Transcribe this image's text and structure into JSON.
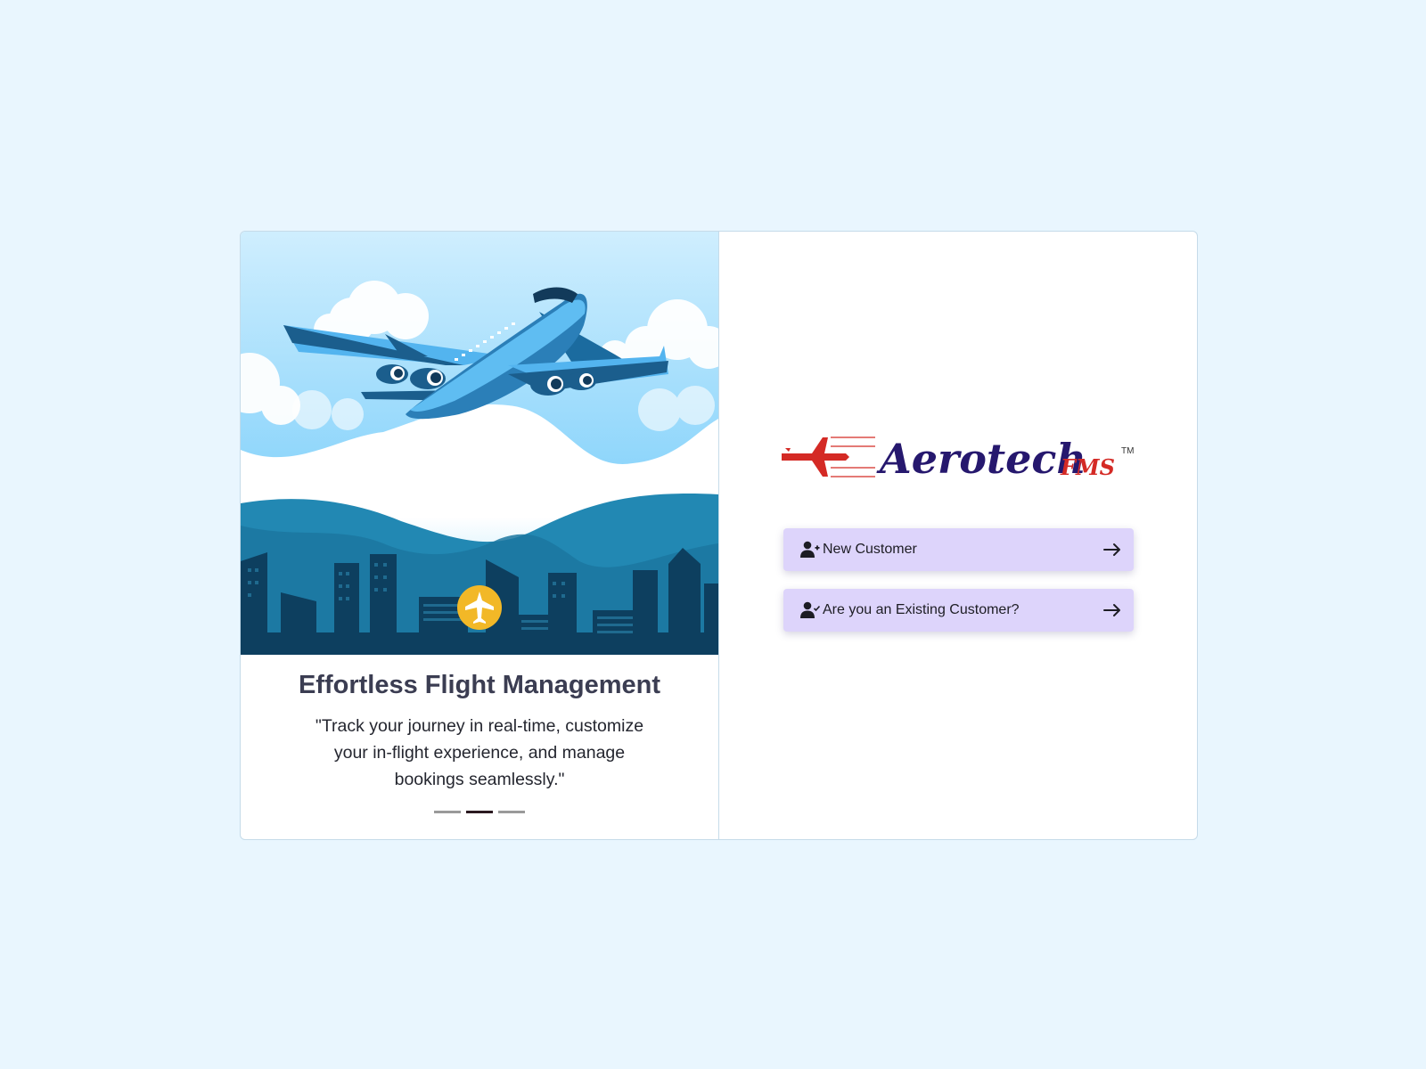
{
  "carousel": {
    "title": "Effortless Flight Management",
    "quote": "\"Track your journey in real-time, customize your in-flight experience, and manage bookings seamlessly.\"",
    "slide_count": 3,
    "active_slide": 2
  },
  "brand": {
    "name": "Aerotech",
    "suffix": "FMS",
    "trademark": "TM",
    "name_color": "#26186e",
    "accent_color": "#d42a25"
  },
  "actions": {
    "new_customer": {
      "label": "New Customer",
      "icon": "user-plus-icon"
    },
    "existing_customer": {
      "label": "Are you an Existing Customer?",
      "icon": "user-check-icon"
    }
  },
  "colors": {
    "page_bg": "#e9f6fe",
    "button_bg": "#ddd4fb",
    "title_color": "#3b3d52"
  }
}
